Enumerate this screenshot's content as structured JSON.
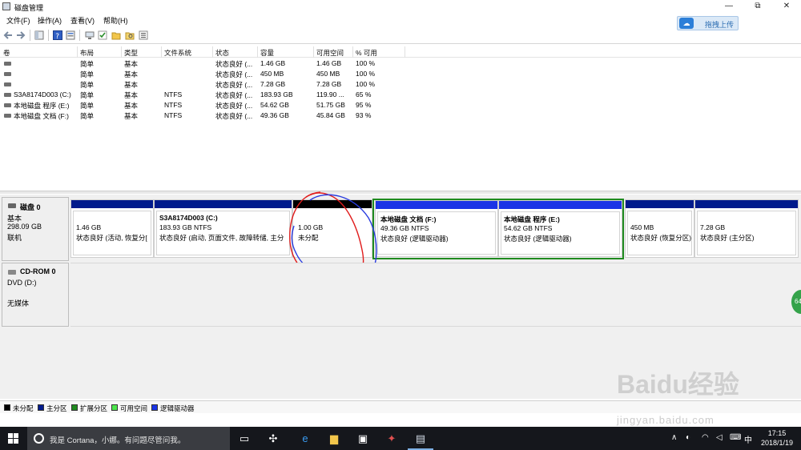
{
  "window": {
    "title": "磁盘管理",
    "controls": [
      "—",
      "⧉",
      "✕"
    ]
  },
  "menu": [
    "文件(F)",
    "操作(A)",
    "查看(V)",
    "帮助(H)"
  ],
  "upload_button": "拖拽上传",
  "columns": [
    "卷",
    "布局",
    "类型",
    "文件系统",
    "状态",
    "容量",
    "可用空间",
    "% 可用"
  ],
  "volumes": [
    {
      "name": "",
      "layout": "简单",
      "type": "基本",
      "fs": "",
      "status": "状态良好 (...",
      "capacity": "1.46 GB",
      "free": "1.46 GB",
      "pct": "100 %"
    },
    {
      "name": "",
      "layout": "简单",
      "type": "基本",
      "fs": "",
      "status": "状态良好 (...",
      "capacity": "450 MB",
      "free": "450 MB",
      "pct": "100 %"
    },
    {
      "name": "",
      "layout": "简单",
      "type": "基本",
      "fs": "",
      "status": "状态良好 (...",
      "capacity": "7.28 GB",
      "free": "7.28 GB",
      "pct": "100 %"
    },
    {
      "name": "S3A8174D003 (C:)",
      "layout": "简单",
      "type": "基本",
      "fs": "NTFS",
      "status": "状态良好 (...",
      "capacity": "183.93 GB",
      "free": "119.90 ...",
      "pct": "65 %"
    },
    {
      "name": "本地磁盘 程序 (E:)",
      "layout": "简单",
      "type": "基本",
      "fs": "NTFS",
      "status": "状态良好 (...",
      "capacity": "54.62 GB",
      "free": "51.75 GB",
      "pct": "95 %"
    },
    {
      "name": "本地磁盘 文档 (F:)",
      "layout": "简单",
      "type": "基本",
      "fs": "NTFS",
      "status": "状态良好 (...",
      "capacity": "49.36 GB",
      "free": "45.84 GB",
      "pct": "93 %"
    }
  ],
  "disk0": {
    "title": "磁盘 0",
    "lines": [
      "基本",
      "298.09 GB",
      "联机"
    ]
  },
  "partitions": [
    {
      "title": "",
      "line1": "1.46 GB",
      "line2": "状态良好 (活动, 恢复分[",
      "color": "#001a8c"
    },
    {
      "title": "S3A8174D003  (C:)",
      "line1": "183.93 GB NTFS",
      "line2": "状态良好 (启动, 页面文件, 故障转储, 主分",
      "color": "#001a8c"
    },
    {
      "title": "",
      "line1": "1.00 GB",
      "line2": "未分配",
      "color": "#000000"
    },
    {
      "title": "本地磁盘 文档  (F:)",
      "line1": "49.36 GB NTFS",
      "line2": "状态良好 (逻辑驱动器)",
      "color": "#1a34e6"
    },
    {
      "title": "本地磁盘 程序  (E:)",
      "line1": "54.62 GB NTFS",
      "line2": "状态良好 (逻辑驱动器)",
      "color": "#1a34e6"
    },
    {
      "title": "",
      "line1": "450 MB",
      "line2": "状态良好 (恢复分区)",
      "color": "#001a8c"
    },
    {
      "title": "",
      "line1": "7.28 GB",
      "line2": "状态良好 (主分区)",
      "color": "#001a8c"
    }
  ],
  "cdrom": {
    "title": "CD-ROM 0",
    "lines": [
      "DVD (D:)",
      "无媒体"
    ]
  },
  "legend": [
    {
      "label": "未分配",
      "color": "#000000"
    },
    {
      "label": "主分区",
      "color": "#001a8c"
    },
    {
      "label": "扩展分区",
      "color": "#1f8a1f"
    },
    {
      "label": "可用空间",
      "color": "#4ce64c"
    },
    {
      "label": "逻辑驱动器",
      "color": "#1a34e6"
    }
  ],
  "taskbar": {
    "search_placeholder": "我是 Cortana，小娜。有问题尽管问我。",
    "time": "17:15",
    "date": "2018/1/19",
    "ime": "中"
  },
  "watermark": {
    "brand": "Baidu经验",
    "url": "jingyan.baidu.com"
  },
  "side_bubble": "64"
}
